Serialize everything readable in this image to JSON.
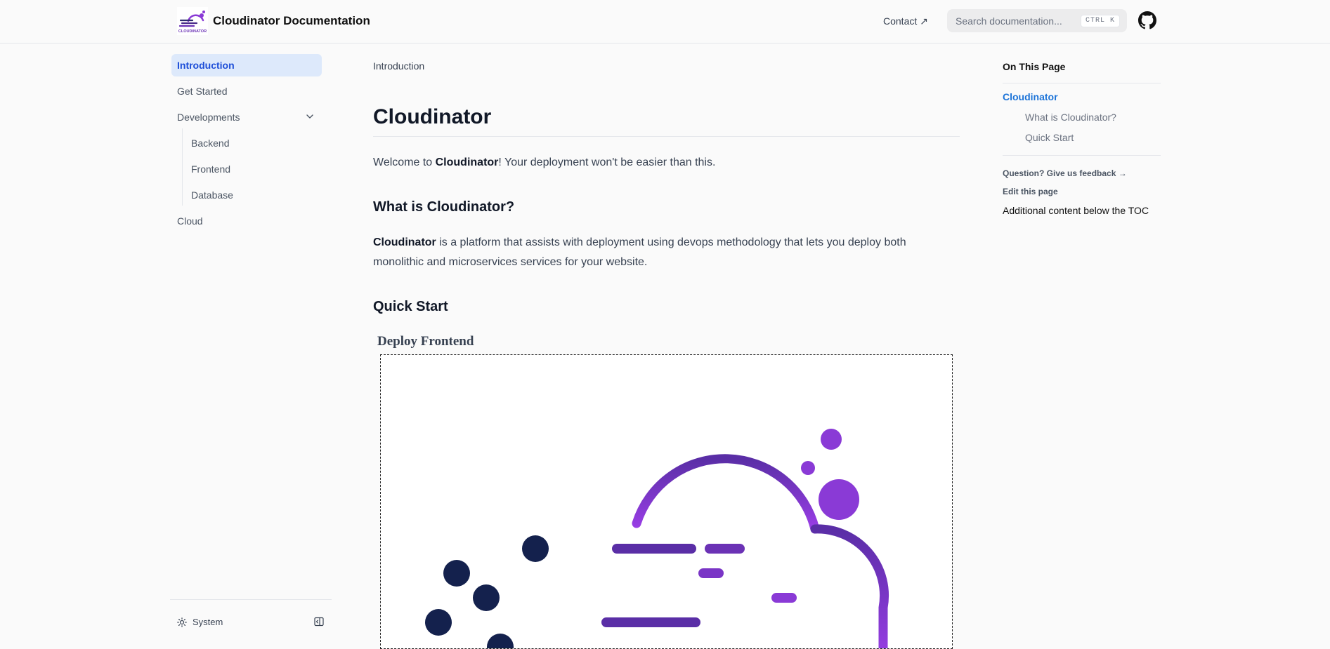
{
  "navbar": {
    "title": "Cloudinator Documentation",
    "contact_label": "Contact ↗",
    "search_placeholder": "Search documentation...",
    "search_shortcut": "CTRL K"
  },
  "sidebar": {
    "items": [
      {
        "label": "Introduction",
        "active": true
      },
      {
        "label": "Get Started"
      },
      {
        "label": "Developments",
        "expanded": true
      },
      {
        "label": "Cloud"
      }
    ],
    "sub_items": [
      {
        "label": "Backend"
      },
      {
        "label": "Frontend"
      },
      {
        "label": "Database"
      }
    ],
    "theme_label": "System"
  },
  "content": {
    "breadcrumb": "Introduction",
    "title": "Cloudinator",
    "intro_before": "Welcome to ",
    "intro_bold": "Cloudinator",
    "intro_after": "! Your deployment won't be easier than this.",
    "section1_title": "What is Cloudinator?",
    "section1_bold": "Cloudinator",
    "section1_text": " is a platform that assists with deployment using devops methodology that lets you deploy both monolithic and microservices services for your website.",
    "section2_title": "Quick Start",
    "deploy_title": "Deploy Frontend"
  },
  "toc": {
    "heading": "On This Page",
    "links": [
      {
        "label": "Cloudinator",
        "active": true
      },
      {
        "label": "What is Cloudinator?"
      },
      {
        "label": "Quick Start"
      }
    ],
    "feedback_label": "Question? Give us feedback →",
    "edit_label": "Edit this page",
    "extra": "Additional content below the TOC"
  },
  "colors": {
    "accent": "#1d74d8",
    "active_bg": "#dde9fb",
    "logo_purple": "#8a3ad6",
    "logo_navy": "#13244a"
  }
}
